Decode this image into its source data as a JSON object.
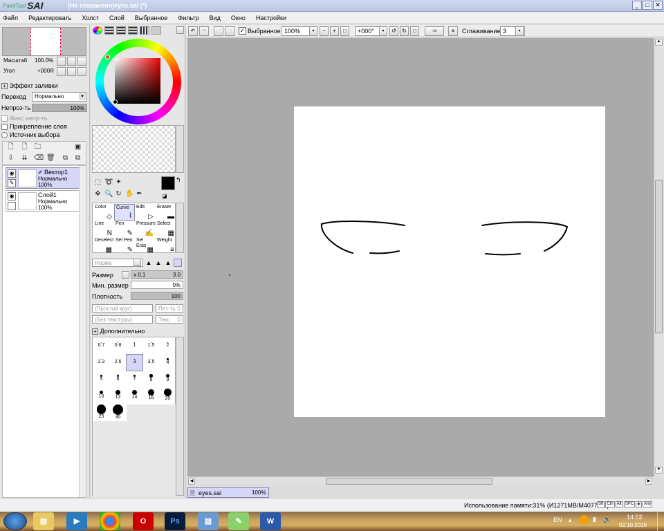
{
  "titlebar": {
    "app_logo_small": "PaintTool",
    "app_logo": "SAI",
    "title": "(Не сохранено)eyes.sai (*)",
    "minimize": "_",
    "maximize": "□",
    "close": "✕"
  },
  "menu": [
    "Файл",
    "Редактировать",
    "Холст",
    "Слой",
    "Выбранное",
    "Фильтр",
    "Вид",
    "Окно",
    "Настройки"
  ],
  "navigator": {
    "zoom_label": "Масштаб",
    "zoom_value": "100.0%",
    "angle_label": "Угол",
    "angle_value": "+000Я"
  },
  "fill_effect": {
    "label": "Эффект заливки",
    "blend_label": "Переход",
    "blend_value": "Нормально",
    "opacity_label": "Непроз-ть",
    "opacity_value": "100%",
    "opacity_fraction": 1.0
  },
  "layer_options": {
    "fix_opacity": "Фикс непр-ть",
    "clip_layer": "Прикрепление слоя",
    "selection_source": "Источник выбора"
  },
  "layers": [
    {
      "name": "Вектор1",
      "mode": "Нормально",
      "opacity": "100%",
      "selected": true
    },
    {
      "name": "Слой1",
      "mode": "Нормально",
      "opacity": "100%",
      "selected": false
    }
  ],
  "tools": [
    {
      "label": "Color",
      "sel": false
    },
    {
      "label": "Curve",
      "sel": true
    },
    {
      "label": "Edit",
      "sel": false
    },
    {
      "label": "Eraser",
      "sel": false
    },
    {
      "label": "Line",
      "sel": false
    },
    {
      "label": "Pen",
      "sel": false
    },
    {
      "label": "Pressure",
      "sel": false
    },
    {
      "label": "Select",
      "sel": false
    },
    {
      "label": "Deselect",
      "sel": false
    },
    {
      "label": "Sel Pen",
      "sel": false
    },
    {
      "label": "Sel Eras",
      "sel": false
    },
    {
      "label": "Weight",
      "sel": false
    }
  ],
  "brush": {
    "mode": "Норма",
    "size_label": "Размер",
    "size_mult": "x 0.1",
    "size_value": "3.0",
    "min_size_label": "Мин. размер",
    "min_size_value": "0%",
    "density_label": "Плотность",
    "density_value": "100",
    "shape": "(Простой круг)",
    "shape_strength_label": "Плт-ть",
    "shape_strength_value": "0",
    "texture": "(Без текстуры)",
    "texture_strength_label": "Текс.",
    "texture_strength_value": "0",
    "advanced_label": "Дополнительно",
    "sizes": [
      "0.7",
      "0.8",
      "1",
      "1.5",
      "2",
      "2.3",
      "2.6",
      "3",
      "3.5",
      "4",
      "5",
      "6",
      "7",
      "8",
      "9",
      "10",
      "12",
      "14",
      "16",
      "20",
      "25",
      "30"
    ],
    "selected_size": "3"
  },
  "canvas_toolbar": {
    "selection_label": "Выбранное",
    "zoom_value": "100%",
    "rotation_value": "+000°",
    "arrow_btn": "->",
    "smoothing_label": "Сглаживание",
    "smoothing_value": "3"
  },
  "document_tab": {
    "name": "eyes.sai",
    "zoom": "100%"
  },
  "status": {
    "memory": "Использование памяти:31% (И1271MB/M4077MB)",
    "keys": [
      "Sft",
      "Ctrl",
      "Alt",
      "SPC",
      "Any"
    ]
  },
  "taskbar": {
    "lang": "EN",
    "time": "14:52",
    "date": "02.10.2016",
    "ps_label": "Ps",
    "word_label": "W"
  },
  "colors": {
    "accent": "#d6d6f8",
    "fg_color": "#000000",
    "bg_color": "#ffffff",
    "canvas_bg": "#aaaaaa"
  }
}
